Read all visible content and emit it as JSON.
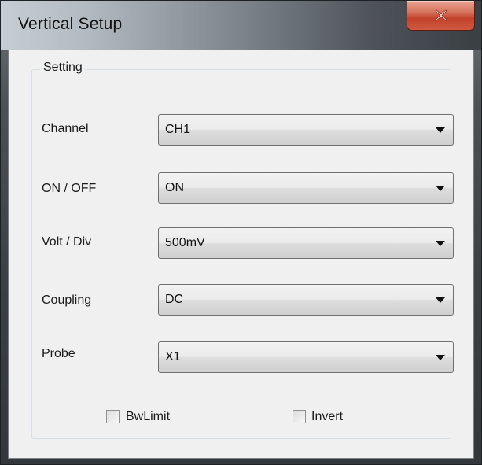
{
  "window": {
    "title": "Vertical Setup",
    "close_icon": "close-icon"
  },
  "group": {
    "label": "Setting"
  },
  "fields": [
    {
      "label": "Channel",
      "value": "CH1"
    },
    {
      "label": "ON / OFF",
      "value": "ON"
    },
    {
      "label": "Volt / Div",
      "value": "500mV"
    },
    {
      "label": "Coupling",
      "value": "DC"
    },
    {
      "label": "Probe",
      "value": "X1"
    }
  ],
  "checkboxes": [
    {
      "label": "BwLimit",
      "checked": false
    },
    {
      "label": "Invert",
      "checked": false
    }
  ],
  "colors": {
    "close_button": "#c2412a",
    "dialog_background": "#f0f0f0"
  }
}
